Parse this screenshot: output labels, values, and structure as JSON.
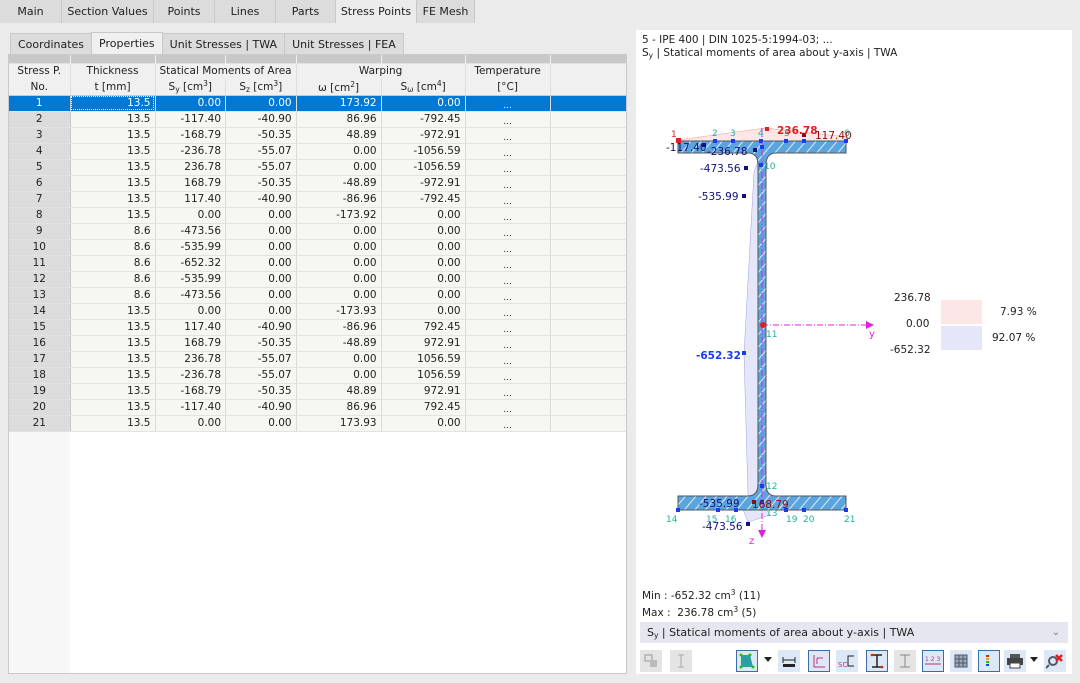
{
  "top_tabs": [
    "Main",
    "Section Values",
    "Points",
    "Lines",
    "Parts",
    "Stress Points",
    "FE Mesh"
  ],
  "top_tab_active": "Stress Points",
  "sub_tabs": [
    "Coordinates",
    "Properties",
    "Unit Stresses | TWA",
    "Unit Stresses | FEA"
  ],
  "sub_tab_active": "Properties",
  "table": {
    "headers": {
      "no_1": "Stress P.",
      "no_2": "No.",
      "thick_1": "Thickness",
      "thick_2": "t [mm]",
      "stat_group": "Statical Moments of Area",
      "sy": "Sy [cm3]",
      "sz": "Sz [cm3]",
      "warp_group": "Warping",
      "omega": "ω [cm2]",
      "somega": "Sω [cm4]",
      "temp_1": "Temperature",
      "temp_2": "[°C]"
    },
    "selected_row": 1,
    "rows": [
      {
        "no": "1",
        "t": "13.5",
        "sy": "0.00",
        "sz": "0.00",
        "w": "173.92",
        "sw": "0.00",
        "temp": "..."
      },
      {
        "no": "2",
        "t": "13.5",
        "sy": "-117.40",
        "sz": "-40.90",
        "w": "86.96",
        "sw": "-792.45",
        "temp": "..."
      },
      {
        "no": "3",
        "t": "13.5",
        "sy": "-168.79",
        "sz": "-50.35",
        "w": "48.89",
        "sw": "-972.91",
        "temp": "..."
      },
      {
        "no": "4",
        "t": "13.5",
        "sy": "-236.78",
        "sz": "-55.07",
        "w": "0.00",
        "sw": "-1056.59",
        "temp": "..."
      },
      {
        "no": "5",
        "t": "13.5",
        "sy": "236.78",
        "sz": "-55.07",
        "w": "0.00",
        "sw": "-1056.59",
        "temp": "..."
      },
      {
        "no": "6",
        "t": "13.5",
        "sy": "168.79",
        "sz": "-50.35",
        "w": "-48.89",
        "sw": "-972.91",
        "temp": "..."
      },
      {
        "no": "7",
        "t": "13.5",
        "sy": "117.40",
        "sz": "-40.90",
        "w": "-86.96",
        "sw": "-792.45",
        "temp": "..."
      },
      {
        "no": "8",
        "t": "13.5",
        "sy": "0.00",
        "sz": "0.00",
        "w": "-173.92",
        "sw": "0.00",
        "temp": "..."
      },
      {
        "no": "9",
        "t": "8.6",
        "sy": "-473.56",
        "sz": "0.00",
        "w": "0.00",
        "sw": "0.00",
        "temp": "..."
      },
      {
        "no": "10",
        "t": "8.6",
        "sy": "-535.99",
        "sz": "0.00",
        "w": "0.00",
        "sw": "0.00",
        "temp": "..."
      },
      {
        "no": "11",
        "t": "8.6",
        "sy": "-652.32",
        "sz": "0.00",
        "w": "0.00",
        "sw": "0.00",
        "temp": "..."
      },
      {
        "no": "12",
        "t": "8.6",
        "sy": "-535.99",
        "sz": "0.00",
        "w": "0.00",
        "sw": "0.00",
        "temp": "..."
      },
      {
        "no": "13",
        "t": "8.6",
        "sy": "-473.56",
        "sz": "0.00",
        "w": "0.00",
        "sw": "0.00",
        "temp": "..."
      },
      {
        "no": "14",
        "t": "13.5",
        "sy": "0.00",
        "sz": "0.00",
        "w": "-173.93",
        "sw": "0.00",
        "temp": "..."
      },
      {
        "no": "15",
        "t": "13.5",
        "sy": "117.40",
        "sz": "-40.90",
        "w": "-86.96",
        "sw": "792.45",
        "temp": "..."
      },
      {
        "no": "16",
        "t": "13.5",
        "sy": "168.79",
        "sz": "-50.35",
        "w": "-48.89",
        "sw": "972.91",
        "temp": "..."
      },
      {
        "no": "17",
        "t": "13.5",
        "sy": "236.78",
        "sz": "-55.07",
        "w": "0.00",
        "sw": "1056.59",
        "temp": "..."
      },
      {
        "no": "18",
        "t": "13.5",
        "sy": "-236.78",
        "sz": "-55.07",
        "w": "0.00",
        "sw": "1056.59",
        "temp": "..."
      },
      {
        "no": "19",
        "t": "13.5",
        "sy": "-168.79",
        "sz": "-50.35",
        "w": "48.89",
        "sw": "972.91",
        "temp": "..."
      },
      {
        "no": "20",
        "t": "13.5",
        "sy": "-117.40",
        "sz": "-40.90",
        "w": "86.96",
        "sw": "792.45",
        "temp": "..."
      },
      {
        "no": "21",
        "t": "13.5",
        "sy": "0.00",
        "sz": "0.00",
        "w": "173.93",
        "sw": "0.00",
        "temp": "..."
      }
    ]
  },
  "panel": {
    "title_line1": "5 - IPE 400 | DIN 1025-5:1994-03; ...",
    "title_line2_sym": "S",
    "title_line2_sub": "y",
    "title_line2_rest": " | Statical moments of area about y-axis | TWA",
    "diagram": {
      "labels": {
        "max_top": "236.78",
        "top_left": "-117.40",
        "top_right": "117.40",
        "top_mid": "-236.78",
        "web_1": "-473.56",
        "web_2": "-535.99",
        "web_min": "-652.32",
        "bot_left": "-535.99",
        "bot_mid": "168.79",
        "bot_low": "-473.56",
        "axis_y": "y",
        "axis_z": "z"
      },
      "point_numbers": [
        "1",
        "2",
        "3",
        "4",
        "5",
        "6",
        "10",
        "11",
        "12",
        "13",
        "14",
        "15",
        "16",
        "19",
        "20",
        "21"
      ]
    },
    "legend": {
      "max": "236.78",
      "zero": "0.00",
      "min": "-652.32",
      "pos_pct": "7.93 %",
      "neg_pct": "92.07 %",
      "pos_color": "#fde6e6",
      "neg_color": "#e6e6fa"
    },
    "min_label": "Min :",
    "min_value": "-652.32 cm",
    "min_exp": "3",
    "min_point": "(11)",
    "max_label": "Max :",
    "max_value": "236.78 cm",
    "max_exp": "3",
    "max_point": "(5)",
    "combo_sym": "S",
    "combo_sub": "y",
    "combo_rest": " | Statical moments of area about y-axis | TWA"
  },
  "toolbar_icons": [
    "import-section-icon",
    "section-outline-icon",
    "render-mode-icon",
    "dimension-icon",
    "axes-icon",
    "shear-center-icon",
    "section-view-icon",
    "section-outline-plain-icon",
    "numbering-icon",
    "grid-icon",
    "color-scale-icon",
    "print-icon",
    "reset-zoom-icon"
  ]
}
